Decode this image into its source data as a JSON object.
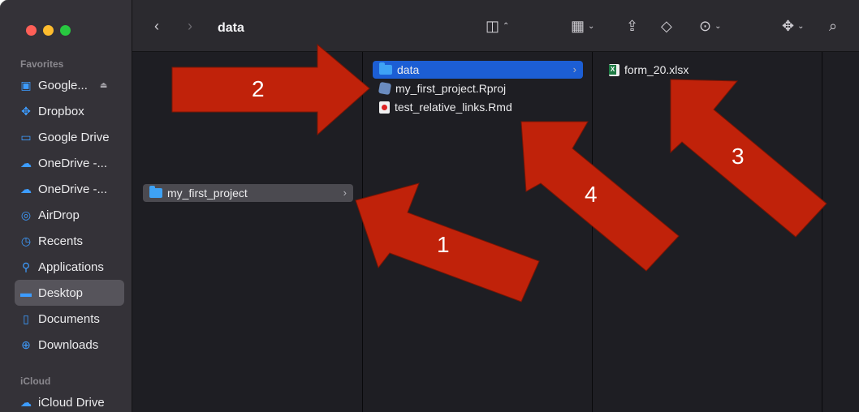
{
  "window": {
    "title": "data",
    "toolbar_icons": [
      "back-icon",
      "forward-icon",
      "column-view-icon",
      "group-icon",
      "share-icon",
      "tag-icon",
      "more-icon",
      "dropbox-icon",
      "search-icon"
    ]
  },
  "sidebar": {
    "favorites_header": "Favorites",
    "favorites": [
      {
        "label": "Google...",
        "icon": "google-drive-volume-icon"
      },
      {
        "label": "Dropbox",
        "icon": "dropbox-icon"
      },
      {
        "label": "Google Drive",
        "icon": "folder-icon"
      },
      {
        "label": "OneDrive -...",
        "icon": "cloud-icon"
      },
      {
        "label": "OneDrive -...",
        "icon": "cloud-icon"
      },
      {
        "label": "AirDrop",
        "icon": "airdrop-icon"
      },
      {
        "label": "Recents",
        "icon": "clock-icon"
      },
      {
        "label": "Applications",
        "icon": "applications-icon"
      },
      {
        "label": "Desktop",
        "icon": "desktop-icon",
        "selected": true
      },
      {
        "label": "Documents",
        "icon": "document-icon"
      },
      {
        "label": "Downloads",
        "icon": "download-icon"
      }
    ],
    "icloud_header": "iCloud",
    "icloud": [
      {
        "label": "iCloud Drive",
        "icon": "cloud-icon"
      }
    ]
  },
  "columns": {
    "col1": [
      {
        "name": "my_first_project",
        "type": "folder",
        "selected": true
      }
    ],
    "col2": [
      {
        "name": "data",
        "type": "folder",
        "selected": true
      },
      {
        "name": "my_first_project.Rproj",
        "type": "rproj"
      },
      {
        "name": "test_relative_links.Rmd",
        "type": "rmd"
      }
    ],
    "col3": [
      {
        "name": "form_20.xlsx",
        "type": "xlsx"
      }
    ]
  },
  "annotations": {
    "color": "#c0220a",
    "arrows": [
      {
        "label": "1"
      },
      {
        "label": "2"
      },
      {
        "label": "3"
      },
      {
        "label": "4"
      }
    ]
  },
  "colors": {
    "selection_blue": "#1c5ed4",
    "sidebar_accent": "#3d9cff",
    "folder": "#3ea2f5"
  }
}
